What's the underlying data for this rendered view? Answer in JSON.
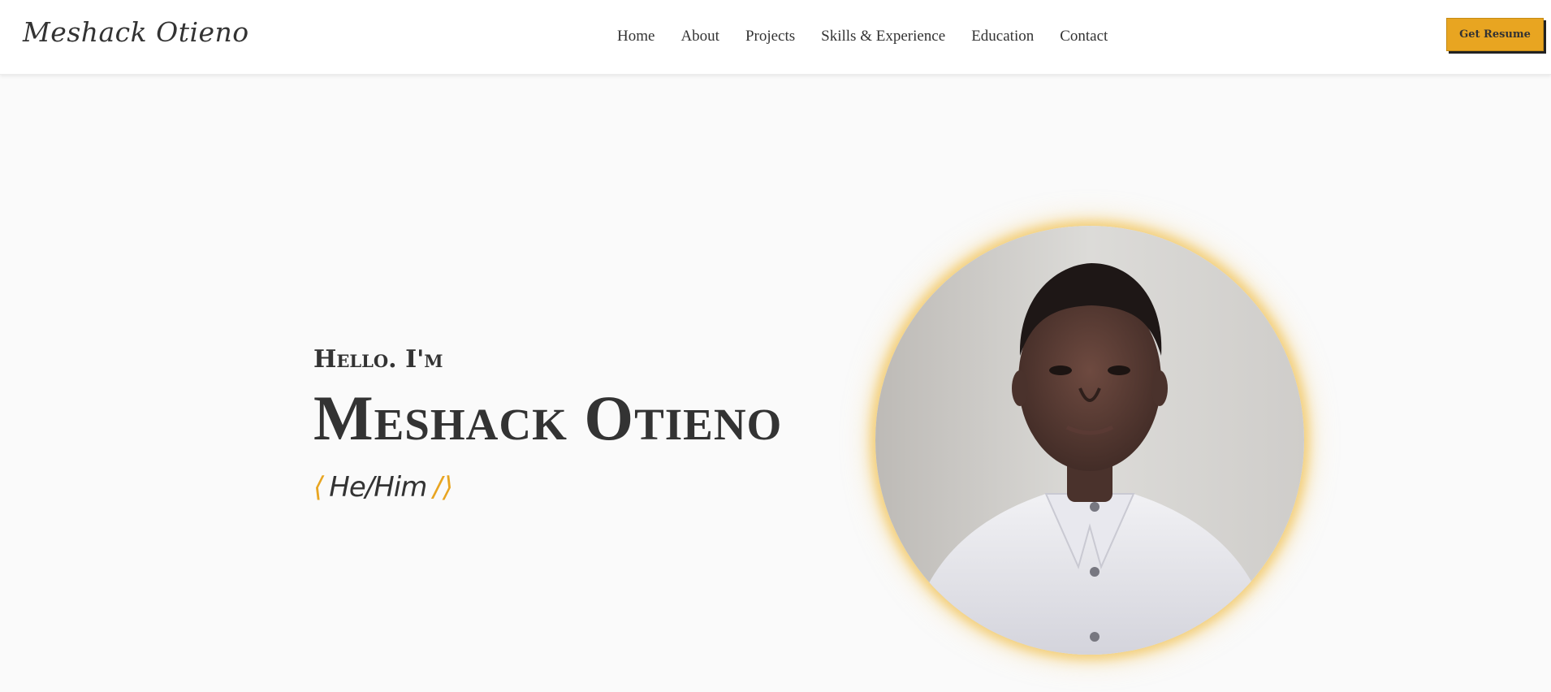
{
  "nav": {
    "logo": "Meshack Otieno",
    "links": [
      "Home",
      "About",
      "Projects",
      "Skills & Experience",
      "Education",
      "Contact"
    ],
    "resume_label": "Get Resume"
  },
  "hero": {
    "greeting": "Hello. I'm",
    "name": "Meshack Otieno",
    "bracket_open": "⟨",
    "pronoun": "He/Him",
    "bracket_close": "/⟩",
    "portrait_icon": "profile-photo"
  },
  "colors": {
    "accent": "#e8a521",
    "text": "#333333",
    "background": "#fafafa"
  }
}
